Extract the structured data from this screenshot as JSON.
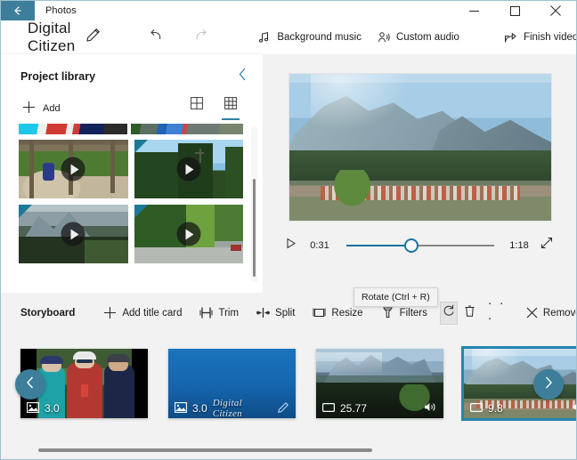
{
  "window": {
    "app_name": "Photos",
    "back_icon": "back-arrow-icon",
    "minimize_icon": "minimize-icon",
    "maximize_icon": "maximize-icon",
    "close_icon": "close-icon"
  },
  "commandbar": {
    "project_title": "Digital Citizen",
    "rename_icon": "pencil-icon",
    "undo_icon": "undo-icon",
    "redo_icon": "redo-icon",
    "items": [
      {
        "label": "Background music",
        "icon": "music-note-icon"
      },
      {
        "label": "Custom audio",
        "icon": "person-audio-icon"
      },
      {
        "label": "Finish video",
        "icon": "export-share-icon"
      }
    ],
    "overflow_label": "· · ·"
  },
  "library": {
    "title": "Project library",
    "collapse_icon": "chevron-left-icon",
    "add_label": "Add",
    "add_icon": "plus-icon",
    "view_large_icon": "grid-large-icon",
    "view_small_icon": "grid-small-icon",
    "active_view": "grid-small",
    "thumbnails": [
      {
        "name": "playground-swing-clip",
        "play_icon": "play-icon",
        "selected": false
      },
      {
        "name": "forest-cross-clip",
        "play_icon": "play-icon",
        "selected": true
      },
      {
        "name": "mountain-haze-clip",
        "play_icon": "play-icon",
        "selected": true
      },
      {
        "name": "trees-road-clip",
        "play_icon": "play-icon",
        "selected": true
      }
    ]
  },
  "preview": {
    "video_name": "mountain-town-preview",
    "play_icon": "play-icon",
    "current_time": "0:31",
    "total_time": "1:18",
    "progress_percent": 44,
    "fullscreen_icon": "expand-icon"
  },
  "tooltip": {
    "text": "Rotate (Ctrl + R)"
  },
  "storyboard": {
    "label": "Storyboard",
    "tools": [
      {
        "label": "Add title card",
        "icon": "plus-icon"
      },
      {
        "label": "Trim",
        "icon": "trim-icon"
      },
      {
        "label": "Split",
        "icon": "split-icon"
      },
      {
        "label": "Resize",
        "icon": "resize-icon"
      },
      {
        "label": "Filters",
        "icon": "filters-icon"
      }
    ],
    "rotate_icon": "rotate-icon",
    "delete_icon": "trash-icon",
    "overflow_label": "· · ·",
    "remove_all_label": "Remove all",
    "remove_all_icon": "close-x-icon",
    "prev_icon": "chevron-left-icon",
    "next_icon": "chevron-right-icon",
    "clips": [
      {
        "name": "cyclists-portrait-clip",
        "duration": "3.0",
        "type_icon": "image-icon",
        "has_audio": false,
        "selected": false,
        "is_title_card": false
      },
      {
        "name": "title-card-clip",
        "duration": "3.0",
        "type_icon": "image-icon",
        "title_text": "Digital Citizen",
        "edit_icon": "pencil-icon",
        "has_audio": false,
        "selected": false,
        "is_title_card": true
      },
      {
        "name": "mountain-ridge-clip",
        "duration": "25.77",
        "type_icon": "video-icon",
        "audio_icon": "speaker-icon",
        "has_audio": true,
        "selected": false,
        "is_title_card": false
      },
      {
        "name": "mountain-town-clip",
        "duration": "9.8",
        "type_icon": "video-icon",
        "audio_icon": "speaker-icon",
        "has_audio": true,
        "selected": true,
        "is_title_card": false
      }
    ]
  },
  "colors": {
    "accent_teal": "#3d7e9a",
    "link_blue": "#2e7fa8",
    "selection_blue": "#2586ae",
    "chrome_gray": "#f2f2f2"
  }
}
